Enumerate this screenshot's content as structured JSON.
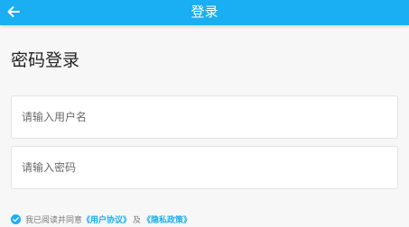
{
  "header": {
    "title": "登录",
    "back_icon": "arrow-left-icon"
  },
  "main": {
    "page_title": "密码登录",
    "username": {
      "placeholder": "请输入用户名",
      "value": ""
    },
    "password": {
      "placeholder": "请输入密码",
      "value": ""
    },
    "agreement": {
      "checked": true,
      "check_icon": "check-circle-icon",
      "prefix": "我已阅读并同意",
      "user_agreement": "《用户协议》",
      "and": "及",
      "privacy_policy": "《隐私政策》"
    }
  },
  "colors": {
    "accent": "#1aaef2",
    "background": "#f7f7f7"
  }
}
